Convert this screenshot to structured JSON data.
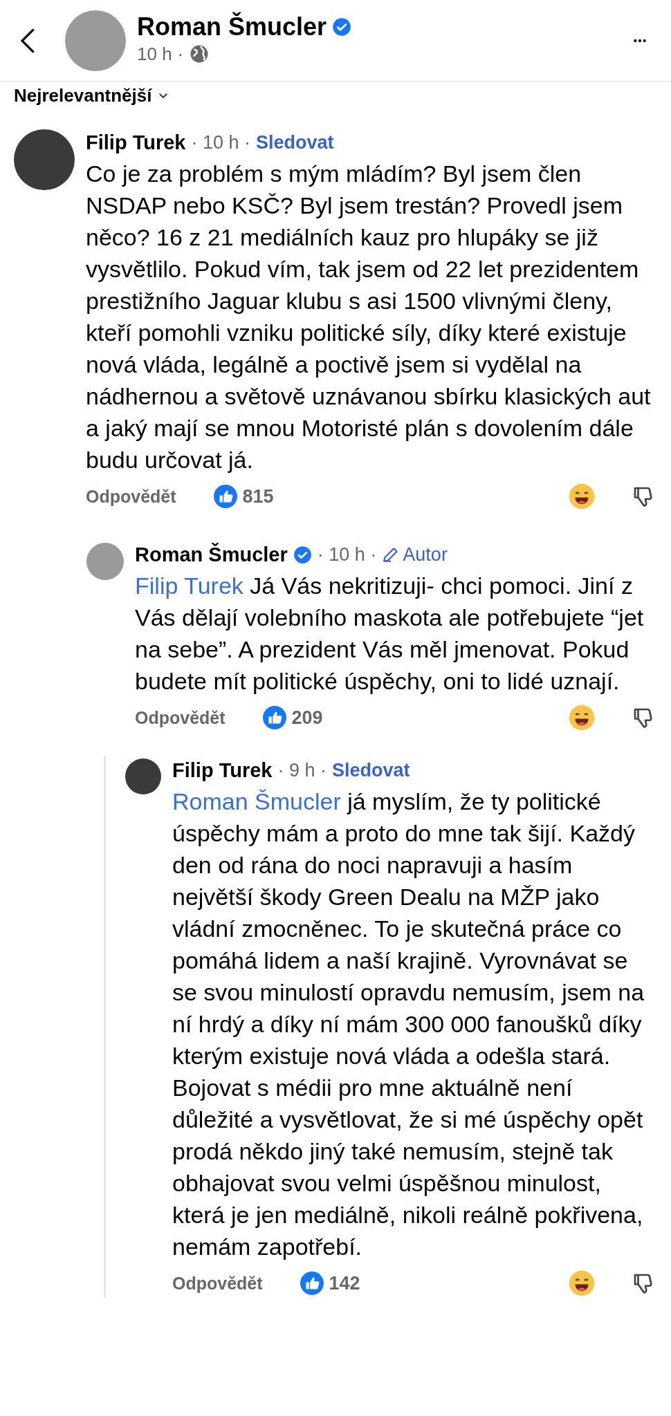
{
  "header": {
    "name": "Roman Šmucler",
    "verified": true,
    "time": "10 h",
    "separator": "·"
  },
  "sort": {
    "label": "Nejrelevantnější"
  },
  "comments": [
    {
      "author": "Filip Turek",
      "verified": false,
      "time": "· 10 h ·",
      "tag": {
        "kind": "follow",
        "label": "Sledovat"
      },
      "text": "Co je za problém s mým mládím? Byl jsem člen NSDAP nebo KSČ? Byl jsem trestán? Provedl jsem něco? 16 z 21 mediálních kauz pro hlupáky se již vysvětlilo. Pokud vím, tak jsem od 22 let prezidentem prestižního Jaguar klubu s asi 1500 vlivnými členy, kteří pomohli vzniku politické síly, díky které existuje nová vláda, legálně a poctivě jsem si vydělal na nádhernou a světově uznávanou sbírku klasických aut a jaký mají se mnou Motoristé plán s dovolením dále budu určovat já.",
      "reply_label": "Odpovědět",
      "likes": "815",
      "children": [
        {
          "author": "Roman Šmucler",
          "verified": true,
          "time": "· 10 h ·",
          "tag": {
            "kind": "author",
            "label": "Autor"
          },
          "mention": "Filip Turek",
          "text": "Já Vás nekritizuji- chci pomoci. Jiní z Vás dělají volebního maskota ale potřebujete “jet na sebe”. A prezident Vás měl jmenovat. Pokud budete mít politické úspěchy, oni to lidé uznají.",
          "reply_label": "Odpovědět",
          "likes": "209",
          "children": [
            {
              "author": "Filip Turek",
              "verified": false,
              "time": "· 9 h ·",
              "tag": {
                "kind": "follow",
                "label": "Sledovat"
              },
              "mention": "Roman Šmucler",
              "text": "já myslím, že ty politické úspěchy mám a proto do mne tak šijí. Každý den od rána do noci napravuji a hasím největší škody Green Dealu na MŽP jako vládní zmocněnec. To je skutečná práce co pomáhá lidem a naší krajině. Vyrovnávat se se svou minulostí opravdu nemusím, jsem na ní hrdý a díky ní mám 300 000 fanoušků díky kterým existuje nová vláda a odešla stará. Bojovat s médii pro mne aktuálně není důležité a vysvětlovat, že si mé úspěchy opět prodá někdo jiný také nemusím, stejně tak obhajovat svou velmi úspěšnou minulost, která je jen mediálně, nikoli reálně pokřivena, nemám zapotřebí.",
              "reply_label": "Odpovědět",
              "likes": "142"
            }
          ]
        }
      ]
    }
  ]
}
